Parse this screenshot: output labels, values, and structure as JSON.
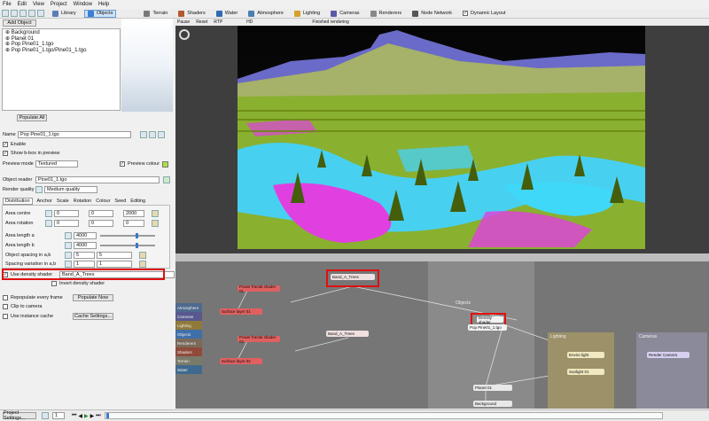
{
  "menu": [
    "File",
    "Edit",
    "View",
    "Project",
    "Window",
    "Help"
  ],
  "tabs": [
    {
      "label": "Library",
      "color": "#5a7fb8"
    },
    {
      "label": "Objects",
      "color": "#3c7fd3"
    },
    {
      "label": "Terrain",
      "color": "#7a7a7a"
    },
    {
      "label": "Shaders",
      "color": "#b35a2e"
    },
    {
      "label": "Water",
      "color": "#2e6ab3"
    },
    {
      "label": "Atmosphere",
      "color": "#4a7fb0"
    },
    {
      "label": "Lighting",
      "color": "#d4a12a"
    },
    {
      "label": "Cameras",
      "color": "#5a5aa8"
    },
    {
      "label": "Renderers",
      "color": "#888"
    },
    {
      "label": "Node Network",
      "color": "#555"
    }
  ],
  "dynamic_layout_label": "Dynamic Layout",
  "scene": {
    "add_object": "Add Object",
    "items": [
      "Background",
      "Planet 01",
      "Pop Pine01_1.tgo",
      "Pop Pine01_1.tgo/Pine01_1.tgo"
    ],
    "populate_all": "Populate All"
  },
  "props": {
    "name_label": "Name",
    "name_value": "Pop Pine01_1.tgo",
    "enable": "Enable",
    "show_bbox": "Show b-box in preview",
    "preview_mode_label": "Preview mode",
    "preview_mode_value": "Textured",
    "preview_colour": "Preview colour",
    "object_reader_label": "Object reader",
    "object_reader_value": "Pine01_1.tgo",
    "render_quality_label": "Render quality",
    "render_quality_value": "Medium quality",
    "subtabs": [
      "Distribution",
      "Anchor",
      "Scale",
      "Rotation",
      "Colour",
      "Seed",
      "Editing"
    ],
    "area_centre_label": "Area centre",
    "area_centre": [
      "0",
      "0",
      "2000"
    ],
    "area_rotation_label": "Area rotation",
    "area_rotation": [
      "0",
      "0",
      "0"
    ],
    "area_length_a_label": "Area length a",
    "area_length_a": "4000",
    "area_length_b_label": "Area length b",
    "area_length_b": "4000",
    "object_spacing_label": "Object spacing in a,b",
    "object_spacing": [
      "5",
      "5"
    ],
    "spacing_variation_label": "Spacing variation in a,b",
    "spacing_variation": [
      "1",
      "1"
    ],
    "use_density_label": "Use density shader",
    "density_value": "Band_A_Trees",
    "invert_density": "Invert density shader",
    "repopulate": "Repopulate every frame",
    "populate_now": "Populate Now",
    "clip_camera": "Clip to camera",
    "use_instance": "Use instance cache",
    "cache_settings": "Cache Settings..."
  },
  "viewport": {
    "buttons": [
      "Pause",
      "Reset",
      "RTP",
      "HD"
    ],
    "status": "Finished rendering"
  },
  "nodes": {
    "sidebar": [
      "Atmosphere",
      "Cameras",
      "Lighting",
      "Objects",
      "Renderers",
      "Shaders",
      "Terrain",
      "Water"
    ],
    "sidebar_colors": [
      "#4f6a8f",
      "#58588f",
      "#8f7a3a",
      "#3f6fa8",
      "#7a6a5a",
      "#8f4a3a",
      "#7a7a6a",
      "#3f6a8f"
    ],
    "band_top": "Band_A_Trees",
    "band_mid": "Band_A_Trees",
    "pfractal1": "Power fractal shader 01",
    "pfractal2": "Power fractal shader 02",
    "surface1": "Surface layer 01",
    "surface2": "Surface layer 02",
    "objects_group": "Objects",
    "density_shader": "Density shader",
    "pop_node": "Pop Pine01_1.tgo",
    "planet": "Planet 01",
    "background": "Background",
    "lighting_group": "Lighting",
    "enviro": "Enviro light",
    "sunlight": "Sunlight 01",
    "cameras_group": "Cameras",
    "render_cam": "Render Camera"
  },
  "statusbar": {
    "project_settings": "Project Settings...",
    "frame": "1"
  }
}
